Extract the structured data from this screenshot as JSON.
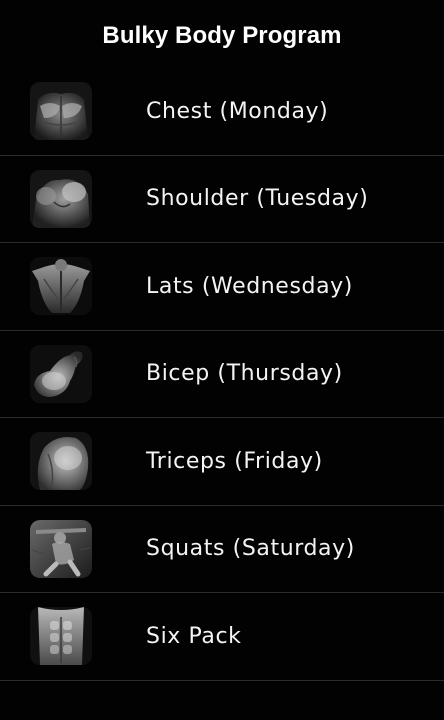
{
  "header": {
    "title": "Bulky Body Program"
  },
  "workouts": [
    {
      "label": "Chest (Monday)",
      "icon": "chest-icon"
    },
    {
      "label": "Shoulder (Tuesday)",
      "icon": "shoulder-icon"
    },
    {
      "label": "Lats (Wednesday)",
      "icon": "lats-icon"
    },
    {
      "label": "Bicep (Thursday)",
      "icon": "bicep-icon"
    },
    {
      "label": "Triceps (Friday)",
      "icon": "triceps-icon"
    },
    {
      "label": "Squats (Saturday)",
      "icon": "squats-icon"
    },
    {
      "label": "Six Pack",
      "icon": "six-pack-icon"
    }
  ],
  "colors": {
    "background": "#020202",
    "text": "#f4f4f4",
    "divider": "#2b2b2b"
  }
}
